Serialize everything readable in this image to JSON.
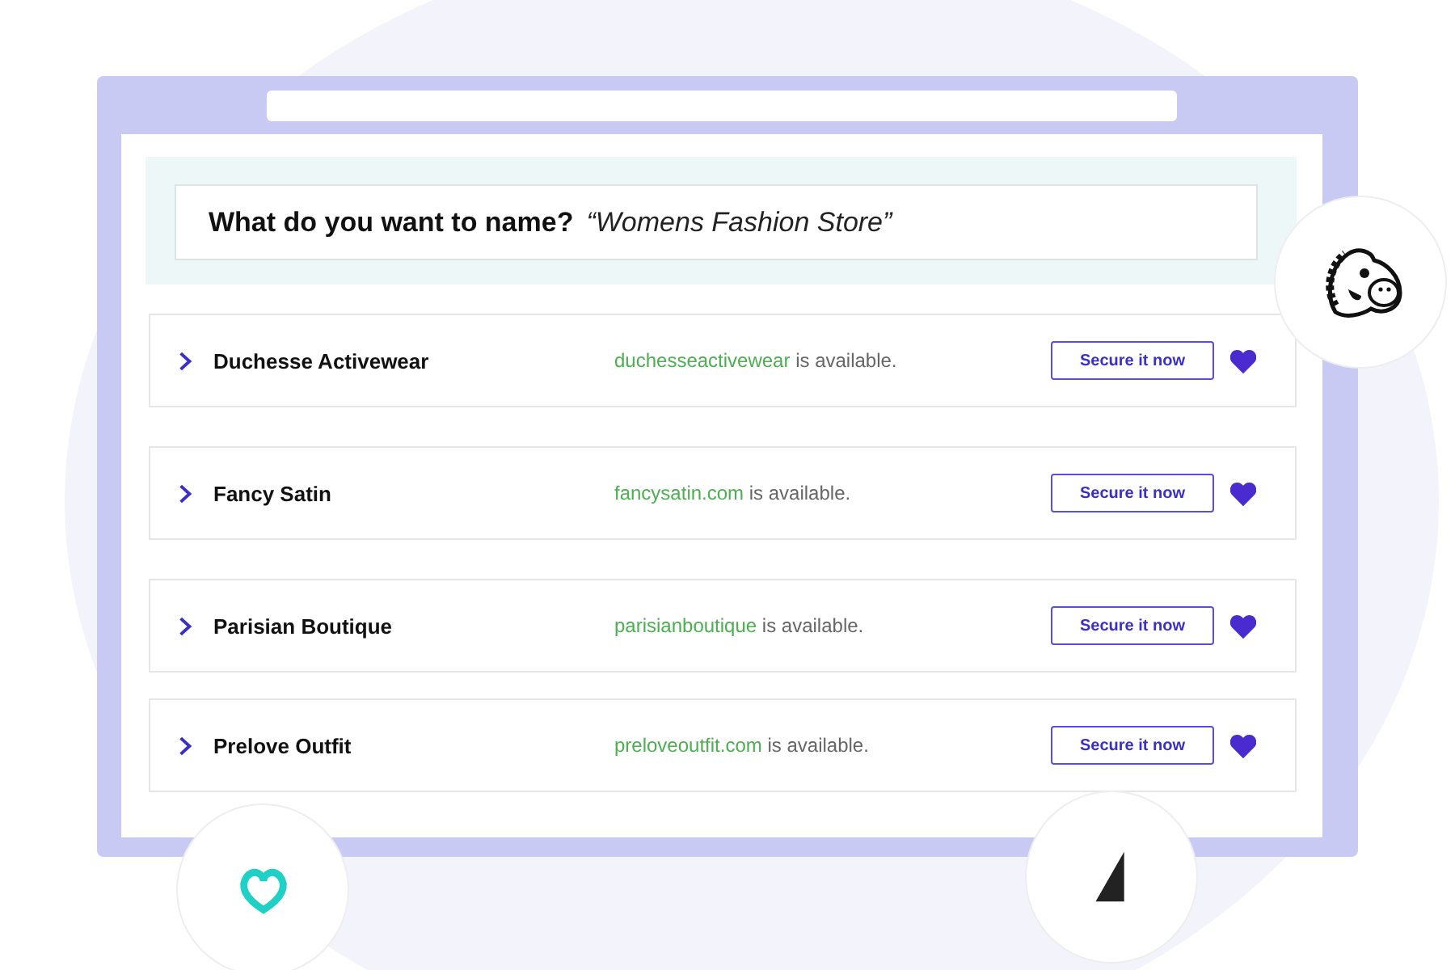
{
  "search": {
    "question": "What do you want to name?",
    "answer": "“Womens Fashion Store”"
  },
  "results": [
    {
      "name": "Duchesse Activewear",
      "domain": "duchesseactivewear",
      "status": "is available.",
      "button": "Secure it now",
      "favorited": true
    },
    {
      "name": "Fancy Satin",
      "domain": "fancysatin.com",
      "status": "is available.",
      "button": "Secure it now",
      "favorited": true
    },
    {
      "name": "Parisian Boutique",
      "domain": "parisianboutique",
      "status": "is available.",
      "button": "Secure it now",
      "favorited": true
    },
    {
      "name": "Prelove Outfit",
      "domain": "preloveoutfit.com",
      "status": "is available.",
      "button": "Secure it now",
      "favorited": true
    }
  ]
}
